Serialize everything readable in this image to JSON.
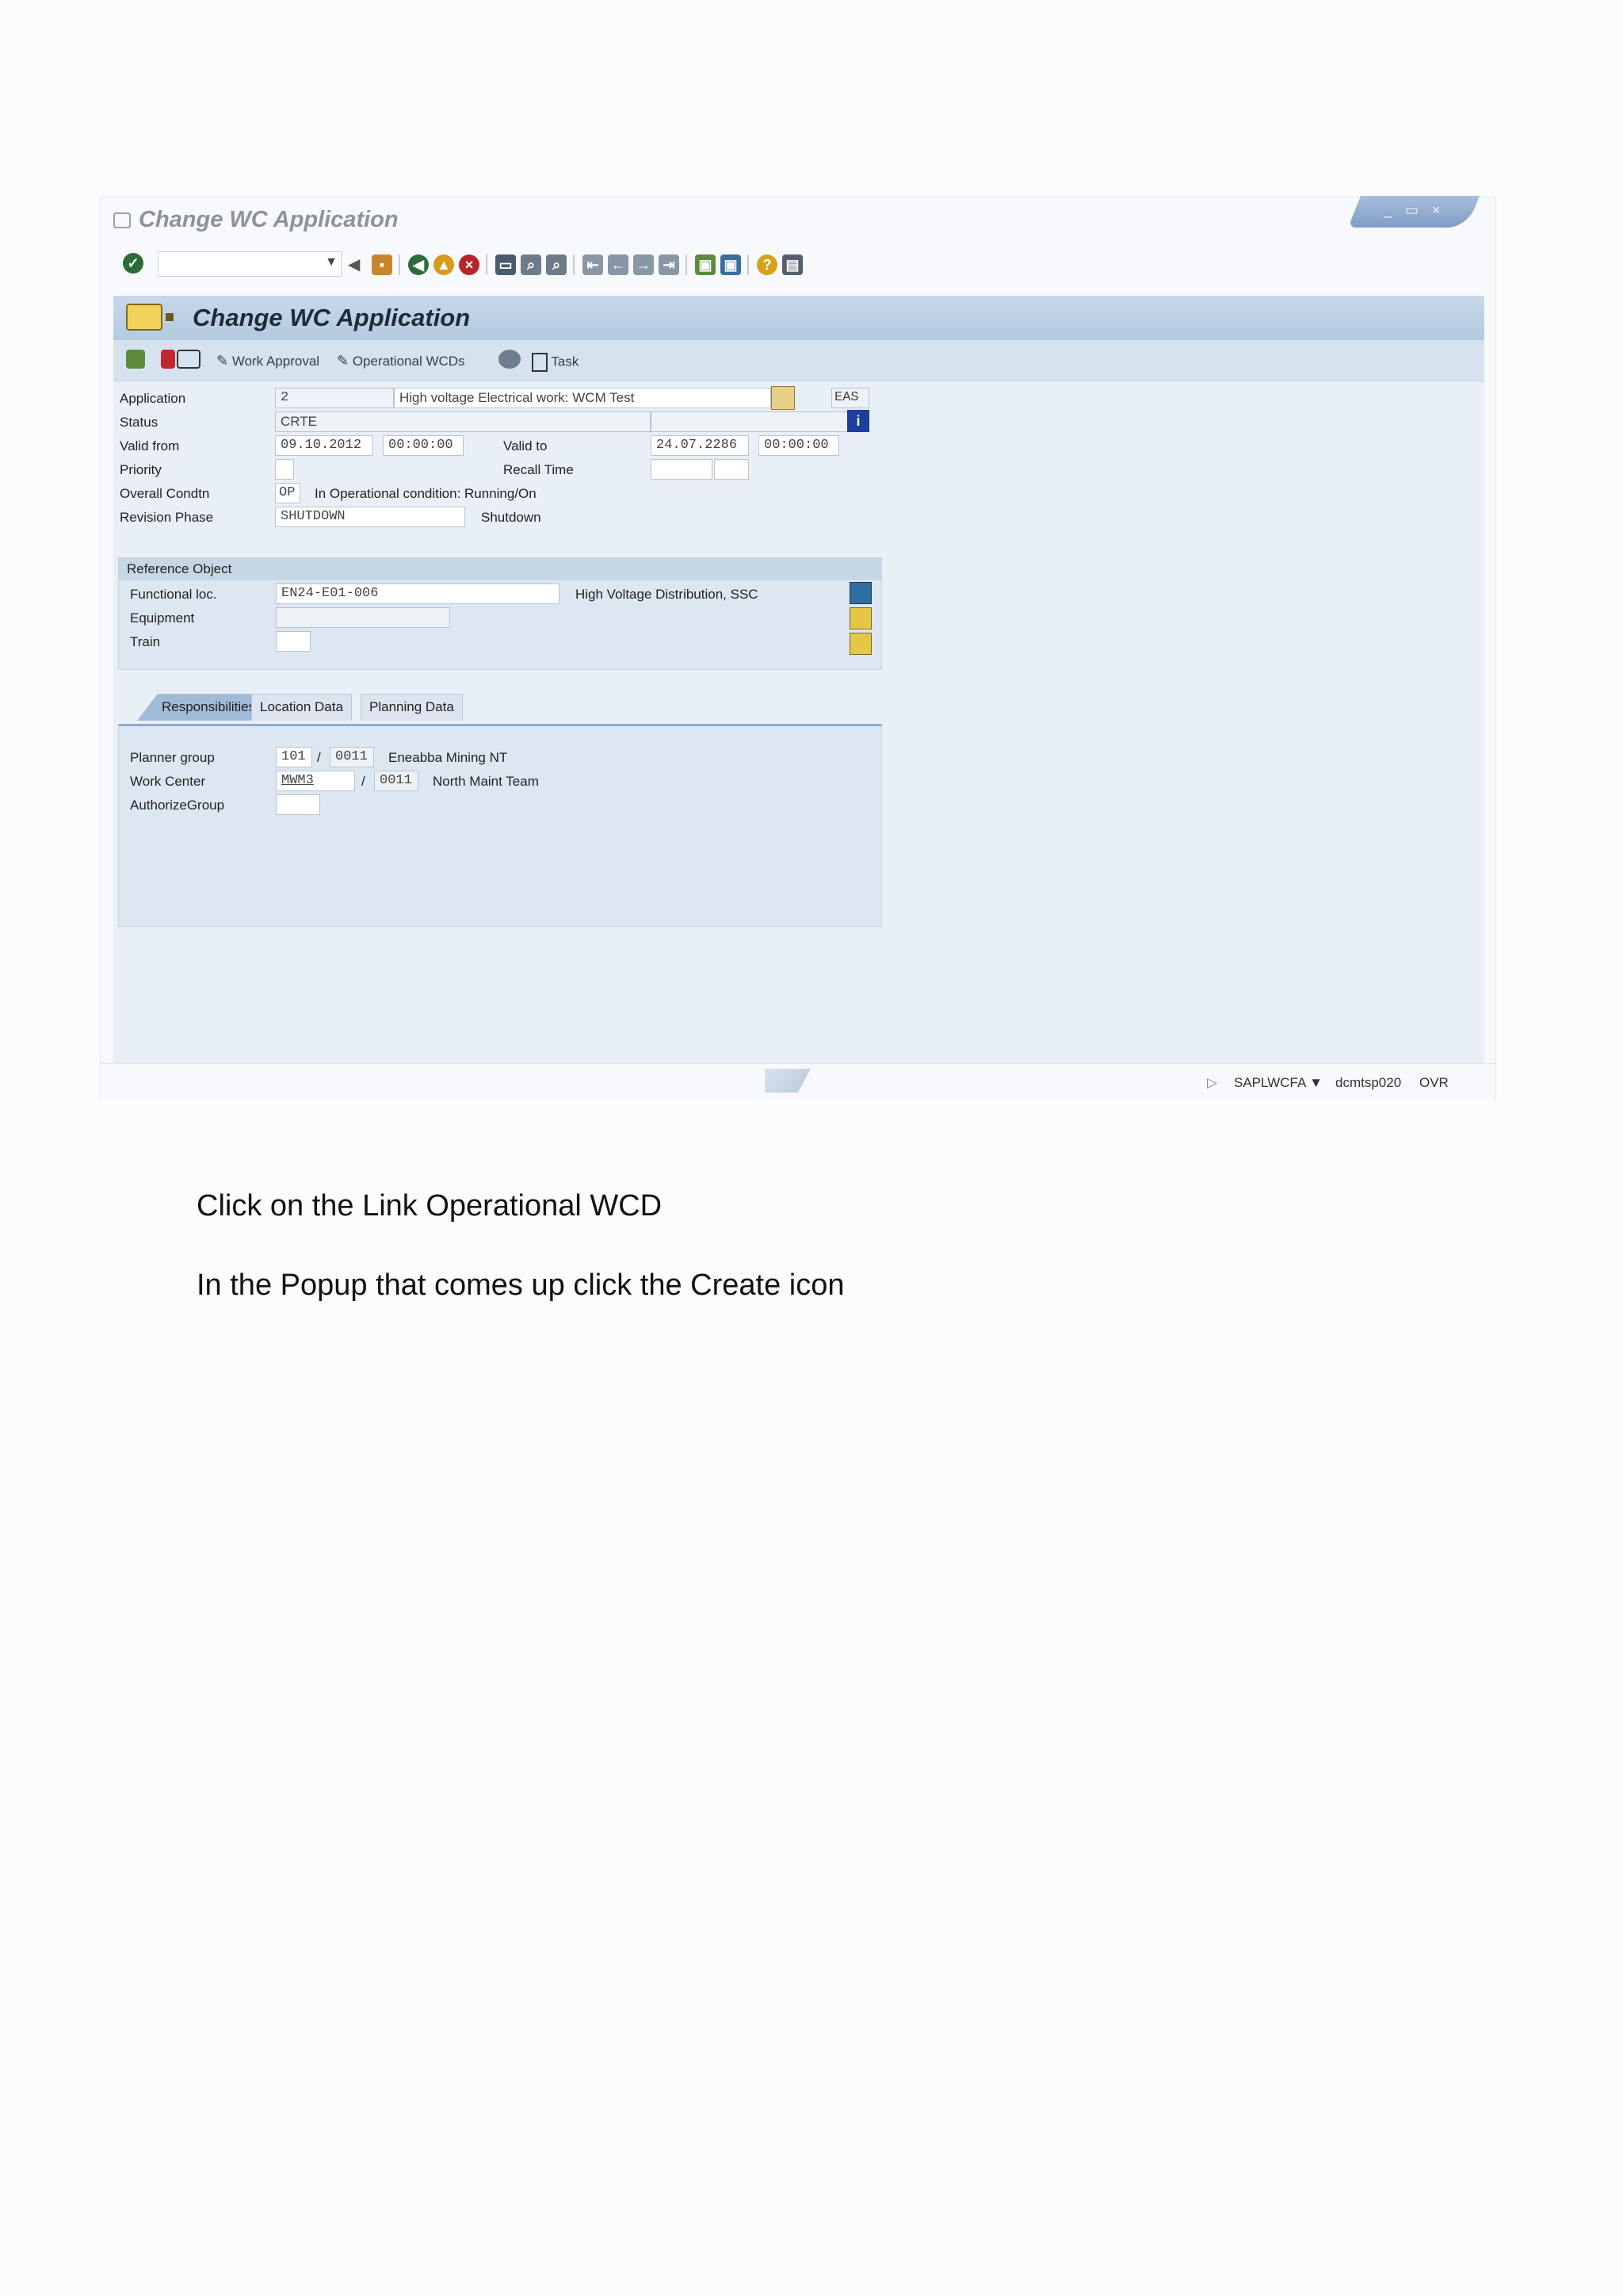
{
  "window": {
    "title": "Change WC Application",
    "controls": "_ ▭ ×"
  },
  "toolbar": {
    "command_field_value": "",
    "buttons": [
      "enter",
      "back",
      "save",
      "back-nav",
      "exit",
      "cancel",
      "print",
      "find",
      "find-next",
      "first-page",
      "previous-page",
      "next-page",
      "last-page",
      "new-session",
      "shortcut",
      "help",
      "customize"
    ]
  },
  "panel": {
    "title": "Change WC Application",
    "app_toolbar": {
      "work_approval": "Work Approval",
      "operational_wcds": "Operational WCDs",
      "task": "Task"
    }
  },
  "form": {
    "application_label": "Application",
    "application_value": "2",
    "application_text": "High voltage Electrical work: WCM Test",
    "application_code": "EAS",
    "status_label": "Status",
    "status_value": "CRTE",
    "valid_from_label": "Valid from",
    "valid_from_date": "09.10.2012",
    "valid_from_time": "00:00:00",
    "valid_to_label": "Valid to",
    "valid_to_date": "24.07.2286",
    "valid_to_time": "00:00:00",
    "priority_label": "Priority",
    "recall_time_label": "Recall Time",
    "overall_condtn_label": "Overall Condtn",
    "overall_condtn_value": "OP",
    "overall_condtn_text": "In Operational condition: Running/On",
    "revision_phase_label": "Revision Phase",
    "revision_phase_value": "SHUTDOWN",
    "revision_phase_text": "Shutdown"
  },
  "reference_object": {
    "heading": "Reference Object",
    "functional_loc_label": "Functional loc.",
    "functional_loc_value": "EN24-E01-006",
    "functional_loc_text": "High Voltage Distribution, SSC",
    "equipment_label": "Equipment",
    "train_label": "Train"
  },
  "tabs": [
    "Responsibilities",
    "Location Data",
    "Planning Data"
  ],
  "responsibilities": {
    "planner_group_label": "Planner group",
    "planner_group_value": "101",
    "planner_group_plant": "0011",
    "planner_group_text": "Eneabba Mining NT",
    "work_center_label": "Work Center",
    "work_center_value": "MWM3",
    "work_center_plant": "0011",
    "work_center_text": "North Maint Team",
    "authorize_group_label": "AuthorizeGroup",
    "separator": "/"
  },
  "status_bar": {
    "program": "SAPLWCFA",
    "server": "dcmtsp020",
    "mode": "OVR"
  },
  "instructions": [
    "Click on the Link Operational WCD",
    "In the Popup that comes up click the Create icon"
  ],
  "colors": {
    "panel_header": "#b4cade",
    "panel_bg": "#e9eff6",
    "active_tab": "#9fbbd8"
  }
}
